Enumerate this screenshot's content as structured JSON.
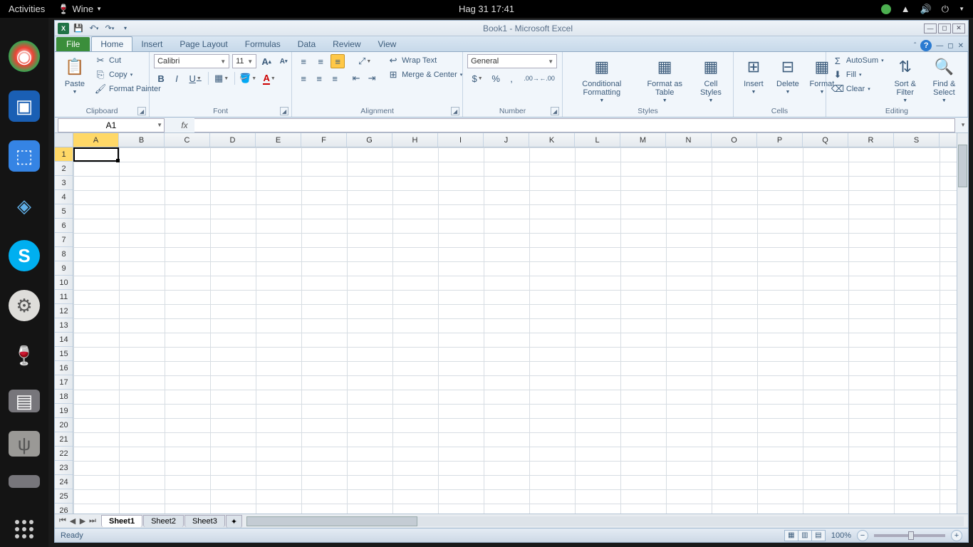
{
  "os": {
    "activities": "Activities",
    "app_menu": "Wine",
    "datetime": "Hag 31  17:41"
  },
  "dock": [
    {
      "name": "chrome",
      "glyph": "◉",
      "bg": "#fff"
    },
    {
      "name": "virtualbox",
      "glyph": "▣",
      "bg": "#1a5fb4"
    },
    {
      "name": "screenshot",
      "glyph": "⧉",
      "bg": "#3584e4"
    },
    {
      "name": "vbox-mgr",
      "glyph": "◆",
      "bg": "#888"
    },
    {
      "name": "skype",
      "glyph": "S",
      "bg": "#00aff0"
    },
    {
      "name": "settings",
      "glyph": "⚙",
      "bg": "#f6f5f4"
    },
    {
      "name": "wine",
      "glyph": "🍷",
      "bg": "transparent"
    },
    {
      "name": "removable",
      "glyph": "▤",
      "bg": "#77767b"
    },
    {
      "name": "usb",
      "glyph": "ψ",
      "bg": "#9a9996"
    },
    {
      "name": "drive",
      "glyph": "▬",
      "bg": "#77767b"
    }
  ],
  "window": {
    "title": "Book1  -  Microsoft Excel"
  },
  "tabs": {
    "file": "File",
    "items": [
      "Home",
      "Insert",
      "Page Layout",
      "Formulas",
      "Data",
      "Review",
      "View"
    ],
    "active": "Home"
  },
  "ribbon": {
    "clipboard": {
      "paste": "Paste",
      "cut": "Cut",
      "copy": "Copy",
      "format_painter": "Format Painter",
      "label": "Clipboard"
    },
    "font": {
      "name": "Calibri",
      "size": "11",
      "label": "Font"
    },
    "alignment": {
      "wrap": "Wrap Text",
      "merge": "Merge & Center",
      "label": "Alignment"
    },
    "number": {
      "format": "General",
      "label": "Number"
    },
    "styles": {
      "cond": "Conditional Formatting",
      "table": "Format as Table",
      "cell": "Cell Styles",
      "label": "Styles"
    },
    "cells": {
      "insert": "Insert",
      "delete": "Delete",
      "format": "Format",
      "label": "Cells"
    },
    "editing": {
      "autosum": "AutoSum",
      "fill": "Fill",
      "clear": "Clear",
      "sort": "Sort & Filter",
      "find": "Find & Select",
      "label": "Editing"
    }
  },
  "namebox": "A1",
  "columns": [
    "A",
    "B",
    "C",
    "D",
    "E",
    "F",
    "G",
    "H",
    "I",
    "J",
    "K",
    "L",
    "M",
    "N",
    "O",
    "P",
    "Q",
    "R",
    "S"
  ],
  "rows": [
    1,
    2,
    3,
    4,
    5,
    6,
    7,
    8,
    9,
    10,
    11,
    12,
    13,
    14,
    15,
    16,
    17,
    18,
    19,
    20,
    21,
    22,
    23,
    24,
    25,
    26
  ],
  "sheets": [
    "Sheet1",
    "Sheet2",
    "Sheet3"
  ],
  "status": {
    "ready": "Ready",
    "zoom": "100%"
  }
}
